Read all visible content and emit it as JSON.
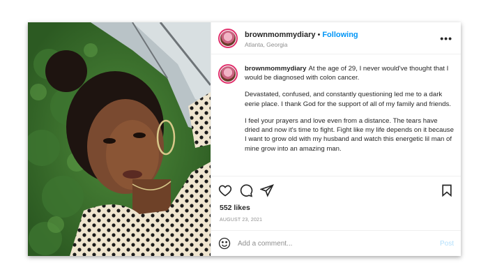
{
  "post": {
    "username": "brownmommydiary",
    "separator": "•",
    "follow_label": "Following",
    "location": "Atlanta, Georgia",
    "more_label": "•••",
    "caption_user": "brownmommydiary",
    "caption_paragraphs": [
      "At the age of 29, I never would've thought that I would be diagnosed with colon cancer.",
      "Devastated, confused, and constantly questioning led me to a dark eerie place. I thank God for the support of all of my family and friends.",
      "I feel your prayers and love even from a distance. The tears have dried and now it's time to fight. Fight like my life depends on it because I want to grow old with my husband and watch this energetic lil man of mine grow into an amazing man."
    ],
    "likes": "552 likes",
    "date": "AUGUST 23, 2021"
  },
  "actions": {
    "like_icon": "heart-icon",
    "comment_icon": "comment-icon",
    "share_icon": "share-icon",
    "save_icon": "bookmark-icon"
  },
  "comment": {
    "placeholder": "Add a comment...",
    "post_label": "Post",
    "emoji_icon": "emoji-icon"
  },
  "colors": {
    "accent": "#0095f6",
    "post_disabled": "#b2dffc",
    "muted": "#8e8e8e",
    "text": "#262626",
    "divider": "#efefef"
  }
}
